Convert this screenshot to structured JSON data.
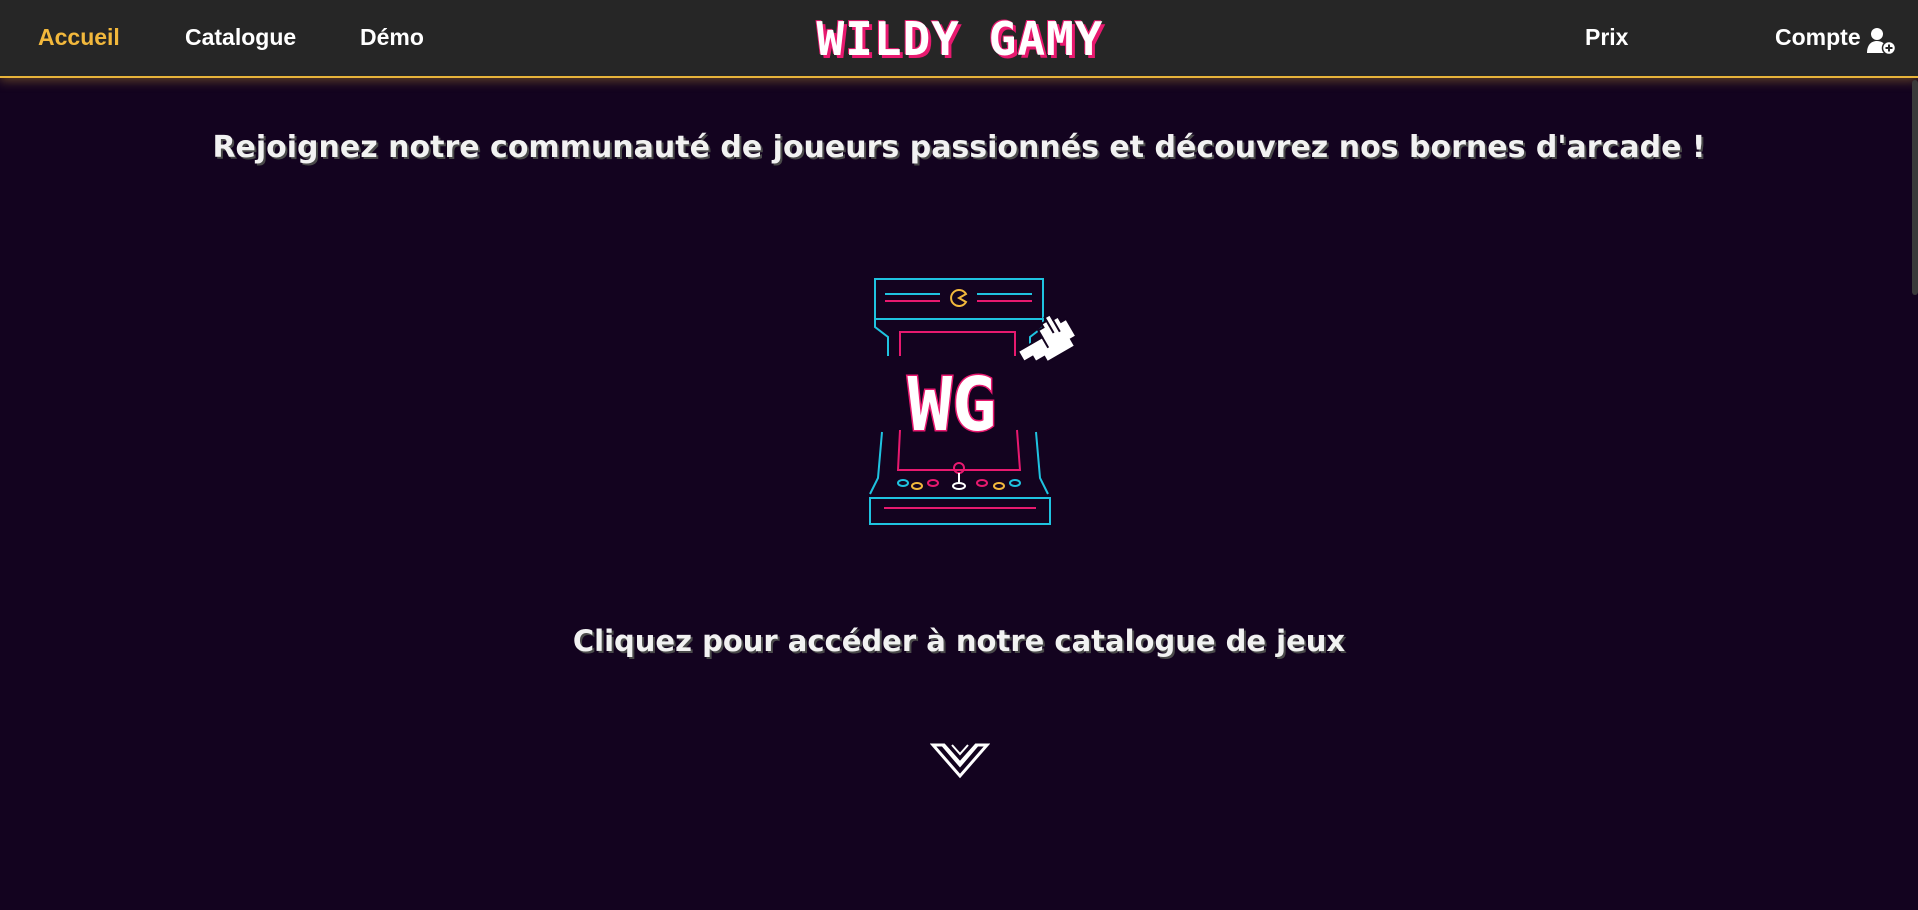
{
  "nav": {
    "home": "Accueil",
    "catalogue": "Catalogue",
    "demo": "Démo",
    "prix": "Prix",
    "compte": "Compte"
  },
  "brand": {
    "logo_text": "WILDY GAMY"
  },
  "hero": {
    "headline": "Rejoignez notre communauté de joueurs passionnés et découvrez nos bornes d'arcade !",
    "arcade_logo": "WG",
    "cta": "Cliquez pour accéder à notre catalogue de jeux"
  },
  "icons": {
    "account": "user-plus-icon",
    "arcade": "arcade-machine-icon",
    "pointer": "pointing-hand-icon",
    "scroll": "chevron-down-icon"
  },
  "colors": {
    "background": "#13031f",
    "navbar": "#262626",
    "accent": "#f2b83c",
    "pink": "#e8196f",
    "cyan": "#1fc3e0"
  }
}
